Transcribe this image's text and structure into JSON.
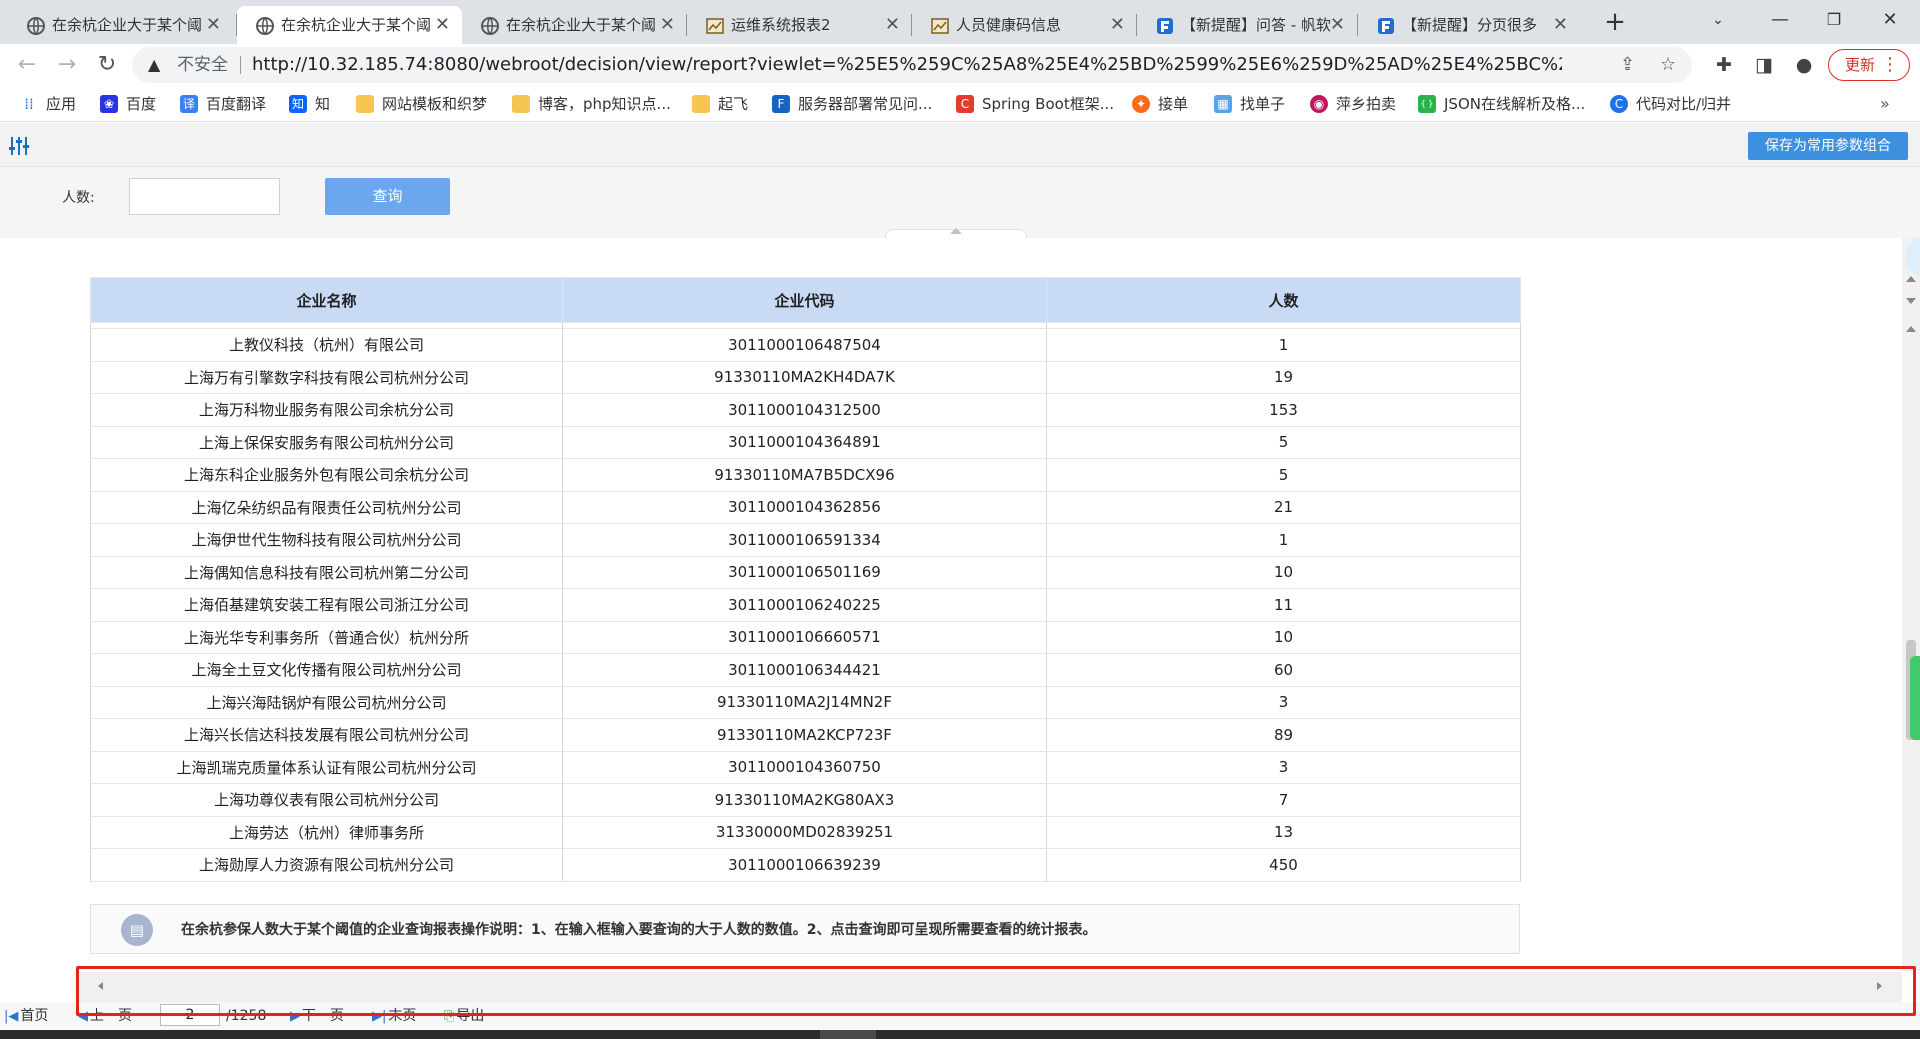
{
  "browser": {
    "tabs": [
      {
        "title": "在余杭企业大于某个阈",
        "icon": "globe-icon",
        "active": false
      },
      {
        "title": "在余杭企业大于某个阈",
        "icon": "globe-icon",
        "active": true
      },
      {
        "title": "在余杭企业大于某个阈",
        "icon": "globe-icon",
        "active": false
      },
      {
        "title": "运维系统报表2",
        "icon": "report-icon",
        "active": false
      },
      {
        "title": "人员健康码信息",
        "icon": "report-icon",
        "active": false
      },
      {
        "title": "【新提醒】问答 - 帆软",
        "icon": "finereport-icon",
        "active": false
      },
      {
        "title": "【新提醒】分页很多",
        "icon": "finereport-icon",
        "active": false
      }
    ],
    "new_tab_label": "+",
    "insecure_label": "不安全",
    "url": "http://10.32.185.74:8080/webroot/decision/view/report?viewlet=%25E5%259C%25A8%25E4%25BD%2599%25E6%259D%25AD%25E4%25BC%2581%25E4%25B...",
    "update_label": "更新"
  },
  "bookmarks": [
    {
      "label": "应用",
      "icon": "apps-icon",
      "color": "#1a73e8"
    },
    {
      "label": "百度",
      "icon": "baidu-icon",
      "color": "#2932e1"
    },
    {
      "label": "百度翻译",
      "icon": "translate-icon",
      "color": "#3a7ff5"
    },
    {
      "label": "知",
      "icon": "zhihu-icon",
      "color": "#0a66ff"
    },
    {
      "label": "网站模板和织梦",
      "icon": "folder-icon",
      "color": "#f5c451"
    },
    {
      "label": "博客，php知识点...",
      "icon": "folder-icon",
      "color": "#f5c451"
    },
    {
      "label": "起飞",
      "icon": "folder-icon",
      "color": "#f5c451"
    },
    {
      "label": "服务器部署常见问...",
      "icon": "finereport-icon",
      "color": "#1565c0"
    },
    {
      "label": "Spring Boot框架...",
      "icon": "csdn-icon",
      "color": "#e33b2e"
    },
    {
      "label": "接单",
      "icon": "order-icon",
      "color": "#ff6a1a"
    },
    {
      "label": "找单子",
      "icon": "grid-icon",
      "color": "#5aa3e8"
    },
    {
      "label": "萍乡拍卖",
      "icon": "auction-icon",
      "color": "#c2185b"
    },
    {
      "label": "JSON在线解析及格...",
      "icon": "json-icon",
      "color": "#2bb24c"
    },
    {
      "label": "代码对比/归并",
      "icon": "diff-icon",
      "color": "#1a73e8"
    }
  ],
  "bookmarks_more": "»",
  "params": {
    "save_combo_label": "保存为常用参数组合",
    "count_label": "人数:",
    "count_value": "",
    "query_label": "查询"
  },
  "report": {
    "headers": [
      "企业名称",
      "企业代码",
      "人数"
    ],
    "rows": [
      [
        "上教仪科技（杭州）有限公司",
        "3011000106487504",
        "1"
      ],
      [
        "上海万有引擎数字科技有限公司杭州分公司",
        "91330110MA2KH4DA7K",
        "19"
      ],
      [
        "上海万科物业服务有限公司余杭分公司",
        "3011000104312500",
        "153"
      ],
      [
        "上海上保保安服务有限公司杭州分公司",
        "3011000104364891",
        "5"
      ],
      [
        "上海东科企业服务外包有限公司余杭分公司",
        "91330110MA7B5DCX96",
        "5"
      ],
      [
        "上海亿朵纺织品有限责任公司杭州分公司",
        "3011000104362856",
        "21"
      ],
      [
        "上海伊世代生物科技有限公司杭州分公司",
        "3011000106591334",
        "1"
      ],
      [
        "上海偶知信息科技有限公司杭州第二分公司",
        "3011000106501169",
        "10"
      ],
      [
        "上海佰基建筑安装工程有限公司浙江分公司",
        "3011000106240225",
        "11"
      ],
      [
        "上海光华专利事务所（普通合伙）杭州分所",
        "3011000106660571",
        "10"
      ],
      [
        "上海全土豆文化传播有限公司杭州分公司",
        "3011000106344421",
        "60"
      ],
      [
        "上海兴海陆锅炉有限公司杭州分公司",
        "91330110MA2J14MN2F",
        "3"
      ],
      [
        "上海兴长信达科技发展有限公司杭州分公司",
        "91330110MA2KCP723F",
        "89"
      ],
      [
        "上海凯瑞克质量体系认证有限公司杭州分公司",
        "3011000104360750",
        "3"
      ],
      [
        "上海功尊仪表有限公司杭州分公司",
        "91330110MA2KG80AX3",
        "7"
      ],
      [
        "上海劳达（杭州）律师事务所",
        "31330000MD02839251",
        "13"
      ],
      [
        "上海勋厚人力资源有限公司杭州分公司",
        "3011000106639239",
        "450"
      ]
    ],
    "note_icon": "document-icon",
    "note_text": "在余杭参保人数大于某个阈值的企业查询报表操作说明：1、在输入框输入要查询的大于人数的数值。2、点击查询即可呈现所需要查看的统计报表。"
  },
  "pager": {
    "first_label": "首页",
    "prev_label": "上一页",
    "current_page": "2",
    "total_pages": "/1258",
    "next_label": "下一页",
    "last_label": "末页",
    "export_label": "导出"
  },
  "colors": {
    "header_bg": "#c8daf4",
    "query_button": "#6aa7ef",
    "save_button": "#3d8fe0",
    "highlight_box": "#e8211a",
    "update_button": "#d93025"
  }
}
